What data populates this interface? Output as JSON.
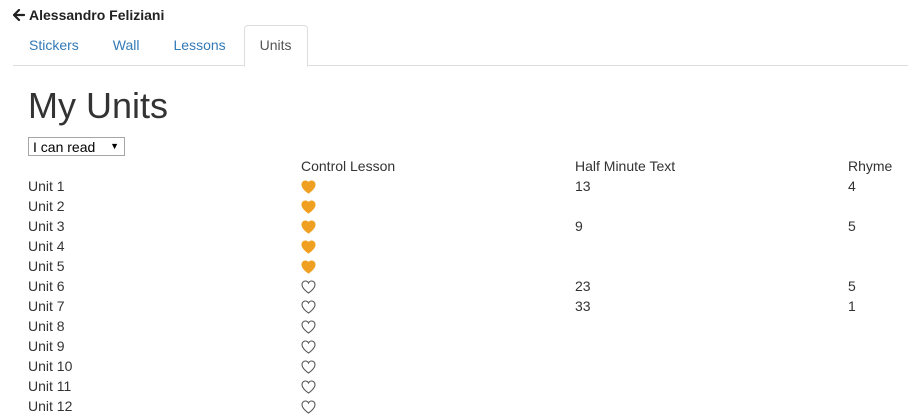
{
  "header": {
    "back_icon": "arrow-left-icon",
    "user_name": "Alessandro Feliziani"
  },
  "tabs": [
    {
      "label": "Stickers",
      "active": false
    },
    {
      "label": "Wall",
      "active": false
    },
    {
      "label": "Lessons",
      "active": false
    },
    {
      "label": "Units",
      "active": true
    }
  ],
  "main": {
    "title": "My Units",
    "filter": {
      "selected": "I can read"
    },
    "columns": {
      "control_lesson": "Control Lesson",
      "half_minute_text": "Half Minute Text",
      "rhyme": "Rhyme"
    },
    "colors": {
      "heart_filled": "#f0a020",
      "heart_outline": "#555555"
    },
    "units": [
      {
        "name": "Unit 1",
        "control_lesson_done": true,
        "half_minute_text": "13",
        "rhyme": "4"
      },
      {
        "name": "Unit 2",
        "control_lesson_done": true,
        "half_minute_text": "",
        "rhyme": ""
      },
      {
        "name": "Unit 3",
        "control_lesson_done": true,
        "half_minute_text": "9",
        "rhyme": "5"
      },
      {
        "name": "Unit 4",
        "control_lesson_done": true,
        "half_minute_text": "",
        "rhyme": ""
      },
      {
        "name": "Unit 5",
        "control_lesson_done": true,
        "half_minute_text": "",
        "rhyme": ""
      },
      {
        "name": "Unit 6",
        "control_lesson_done": false,
        "half_minute_text": "23",
        "rhyme": "5"
      },
      {
        "name": "Unit 7",
        "control_lesson_done": false,
        "half_minute_text": "33",
        "rhyme": "1"
      },
      {
        "name": "Unit 8",
        "control_lesson_done": false,
        "half_minute_text": "",
        "rhyme": ""
      },
      {
        "name": "Unit 9",
        "control_lesson_done": false,
        "half_minute_text": "",
        "rhyme": ""
      },
      {
        "name": "Unit 10",
        "control_lesson_done": false,
        "half_minute_text": "",
        "rhyme": ""
      },
      {
        "name": "Unit 11",
        "control_lesson_done": false,
        "half_minute_text": "",
        "rhyme": ""
      },
      {
        "name": "Unit 12",
        "control_lesson_done": false,
        "half_minute_text": "",
        "rhyme": ""
      }
    ]
  }
}
